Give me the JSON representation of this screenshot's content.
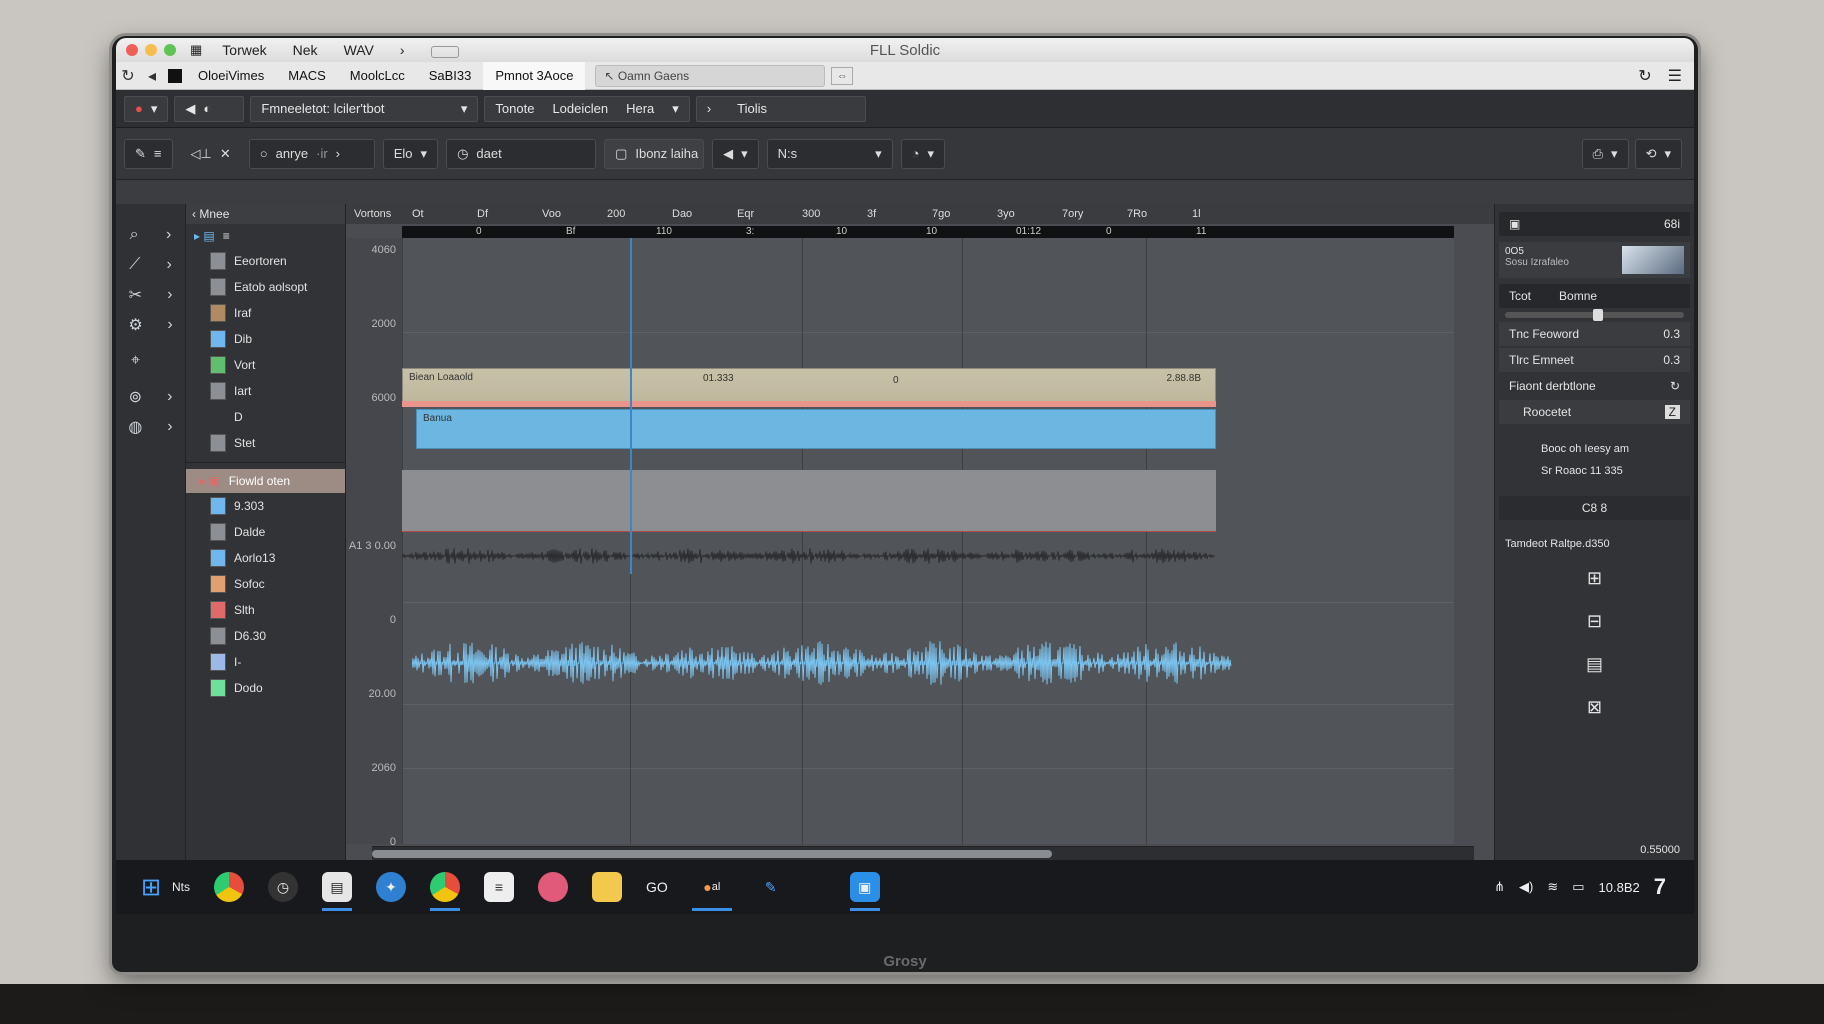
{
  "window": {
    "title": "FLL Soldic",
    "menu": [
      "Torwek",
      "Nek",
      "WAV"
    ]
  },
  "tabs": {
    "items": [
      "OloeiVimes",
      "MACS",
      "MoolcLcc",
      "SaBI33",
      "Pmnot 3Aoce"
    ],
    "address": "Oamn  Gaens"
  },
  "transport": {
    "project": "Fmneeletot: lciler'tbot",
    "items": [
      "Tonote",
      "Lodeiclen",
      "Hera",
      "Tiolis"
    ]
  },
  "toolbar": {
    "mode": "anrye",
    "mode_sub": "·ir",
    "step": "Elo",
    "chord": "daet",
    "snap": "Ibonz laiha",
    "pattern": "N:s"
  },
  "browser": {
    "header": "Mnee",
    "items": [
      {
        "label": "Eeortoren",
        "color": "#8c8f94"
      },
      {
        "label": "Eatob aolsopt",
        "color": "#8c8f94"
      },
      {
        "label": "Iraf",
        "color": "#b08a62"
      },
      {
        "label": "Dib",
        "color": "#6fb7ee"
      },
      {
        "label": "Vort",
        "color": "#5fbf6f"
      },
      {
        "label": "Iart",
        "color": "#8c8f94"
      },
      {
        "label": "D",
        "color": ""
      },
      {
        "label": "Stet",
        "color": "#8c8f94"
      }
    ],
    "section": "Fiowld oten",
    "items2": [
      {
        "label": "9.303",
        "color": "#6fb7ee"
      },
      {
        "label": "Dalde",
        "color": "#8c8f94"
      },
      {
        "label": "Aorlo13",
        "color": "#6fb7ee"
      },
      {
        "label": "Sofoc",
        "color": "#e0a070"
      },
      {
        "label": "Slth",
        "color": "#e06a6a"
      },
      {
        "label": "D6.30",
        "color": "#8c8f94"
      },
      {
        "label": "I-",
        "color": "#9bb8e6"
      },
      {
        "label": "Dodo",
        "color": "#6fe09a"
      }
    ]
  },
  "ruler": {
    "label": "Vortons",
    "marks": [
      "Ot",
      "Df",
      "Voo",
      "200",
      "Dao",
      "Eqr",
      "300",
      "3f",
      "7go",
      "3yo",
      "7ory",
      "7Ro",
      "1l"
    ],
    "timeline": [
      "0",
      "Bf",
      "110",
      "3:",
      "10",
      "10",
      "01:12",
      "0",
      "11"
    ]
  },
  "yaxis": [
    "4060",
    "2000",
    "6000",
    "",
    "A1 3 0.00",
    "0",
    "20.00",
    "2060",
    "0"
  ],
  "clips": {
    "top_left": "Biean Loaaold",
    "top_mid": "01.333",
    "top_mid2": "0",
    "top_right": "2.88.8B",
    "blue": "Banua"
  },
  "panel": {
    "head_left": "",
    "head_right": "68i",
    "thumb_label": "0O5",
    "thumb_sub": "Sosu Izrafaleo",
    "tabs": [
      "Tcot",
      "Bomne"
    ],
    "rows": [
      {
        "label": "Tnc Feoword",
        "value": "0.3"
      },
      {
        "label": "Tlrc Emneet",
        "value": "0.3"
      }
    ],
    "section": "Fiaont derbtlone",
    "preset": "Roocetet",
    "preset_badge": "Z",
    "note1": "Booc oh Ieesy am",
    "note2": "Sr Roaoc 11 335",
    "divider": "C8 8",
    "info": "Tamdeot Raltpe.d350",
    "footer": "0.55000"
  },
  "taskbar": {
    "start_label": "Nts",
    "clock_label": "GO",
    "dot_label": "al",
    "tray_time": "10.8B2",
    "brand": "Grosy"
  }
}
